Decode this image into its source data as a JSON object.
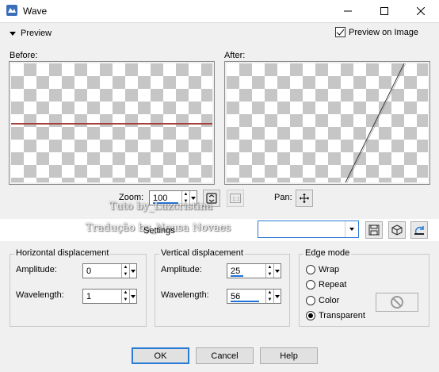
{
  "window": {
    "title": "Wave"
  },
  "preview": {
    "toggle_label": "Preview",
    "preview_on_image_label": "Preview on Image",
    "preview_on_image_checked": true
  },
  "panes": {
    "before_label": "Before:",
    "after_label": "After:"
  },
  "zoom": {
    "label": "Zoom:",
    "value": "100",
    "pan_label": "Pan:"
  },
  "watermark": {
    "line1": "Tuto by_Luzcristina",
    "line2": "Tradução by_Neusa Novaes"
  },
  "settings": {
    "label": "Settings",
    "value": ""
  },
  "horizontal": {
    "title": "Horizontal displacement",
    "amplitude_label": "Amplitude:",
    "amplitude": "0",
    "wavelength_label": "Wavelength:",
    "wavelength": "1"
  },
  "vertical": {
    "title": "Vertical displacement",
    "amplitude_label": "Amplitude:",
    "amplitude": "25",
    "wavelength_label": "Wavelength:",
    "wavelength": "56"
  },
  "edge_mode": {
    "title": "Edge mode",
    "options": [
      "Wrap",
      "Repeat",
      "Color",
      "Transparent"
    ],
    "selected": "Transparent"
  },
  "buttons": {
    "ok": "OK",
    "cancel": "Cancel",
    "help": "Help"
  },
  "colors": {
    "accent": "#1e72d8",
    "before_line": "#a0413b"
  }
}
